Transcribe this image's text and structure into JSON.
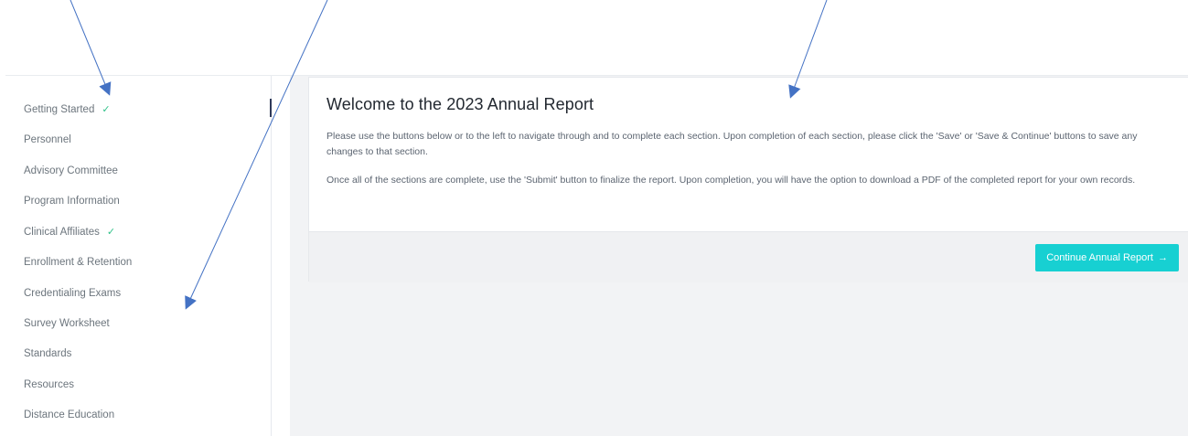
{
  "sidebar": {
    "items": [
      {
        "label": "Getting Started",
        "completed": true
      },
      {
        "label": "Personnel",
        "completed": false
      },
      {
        "label": "Advisory Committee",
        "completed": false
      },
      {
        "label": "Program Information",
        "completed": false
      },
      {
        "label": "Clinical Affiliates",
        "completed": true
      },
      {
        "label": "Enrollment & Retention",
        "completed": false
      },
      {
        "label": "Credentialing Exams",
        "completed": false
      },
      {
        "label": "Survey Worksheet",
        "completed": false
      },
      {
        "label": "Standards",
        "completed": false
      },
      {
        "label": "Resources",
        "completed": false
      },
      {
        "label": "Distance Education",
        "completed": false
      }
    ],
    "check_glyph": "✓",
    "check_color": "#31c28a"
  },
  "main": {
    "title": "Welcome to the 2023 Annual Report",
    "paragraph_1": "Please use the buttons below or to the left to navigate through and to complete each section. Upon completion of each section, please click the 'Save' or 'Save & Continue' buttons to save any changes to that section.",
    "paragraph_2": "Once all of the sections are complete, use the 'Submit' button to finalize the report. Upon completion, you will have the option to download a PDF of the completed report for your own records.",
    "continue_label": "Continue Annual Report",
    "continue_arrow": "→",
    "button_color": "#17d0d2"
  },
  "annotation_color": "#4472c4"
}
